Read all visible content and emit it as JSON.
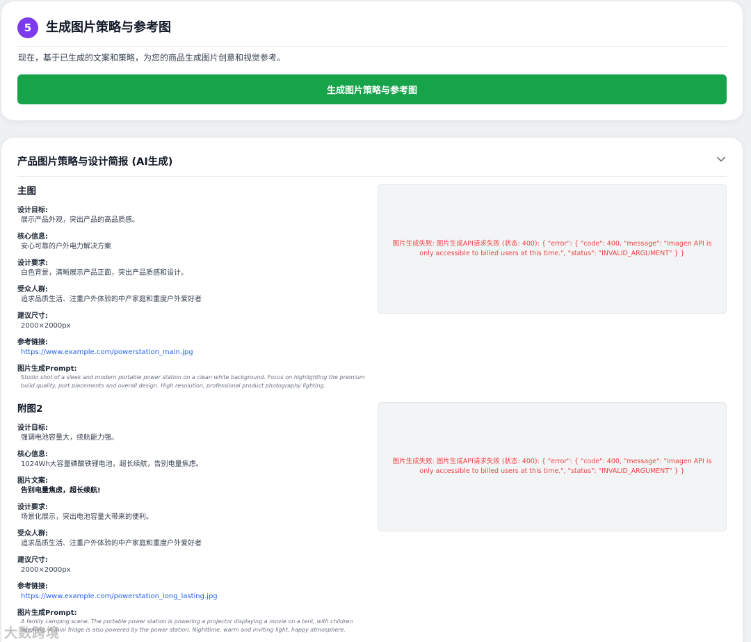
{
  "step": {
    "number": "5",
    "title": "生成图片策略与参考图",
    "description": "现在，基于已生成的文案和策略，为您的商品生成图片创意和视觉参考。",
    "button_label": "生成图片策略与参考图"
  },
  "brief": {
    "title": "产品图片策略与设计简报 (AI生成)",
    "toggle_icon": "chevron-down-icon",
    "sections": [
      {
        "title": "主图",
        "fields": [
          {
            "label": "设计目标:",
            "value": "展示产品外观，突出产品的高品质感。"
          },
          {
            "label": "核心信息:",
            "value": "安心可靠的户外电力解决方案"
          },
          {
            "label": "设计要求:",
            "value": "白色背景，清晰展示产品正面，突出产品质感和设计。"
          },
          {
            "label": "受众人群:",
            "value": "追求品质生活、注重户外体验的中产家庭和重度户外爱好者"
          },
          {
            "label": "建议尺寸:",
            "value": "2000×2000px"
          },
          {
            "label": "参考链接:",
            "value": "https://www.example.com/powerstation_main.jpg"
          },
          {
            "label": "图片生成Prompt:",
            "value": "Studio shot of a sleek and modern portable power station on a clean white background. Focus on highlighting the premium build quality, port placements and overall design. High resolution, professional product photography lighting."
          }
        ],
        "image_error": "图片生成失败: 图片生成API请求失败 (状态: 400): { \"error\": { \"code\": 400, \"message\": \"Imagen API is only accessible to billed users at this time.\", \"status\": \"INVALID_ARGUMENT\" } }"
      },
      {
        "title": "附图2",
        "fields": [
          {
            "label": "设计目标:",
            "value": "强调电池容量大，续航能力强。"
          },
          {
            "label": "核心信息:",
            "value": "1024Wh大容量磷酸铁锂电池，超长续航，告别电量焦虑。"
          },
          {
            "label": "图片文案:",
            "value": "告别电量焦虑，超长续航!"
          },
          {
            "label": "设计要求:",
            "value": "场景化展示，突出电池容量大带来的便利。"
          },
          {
            "label": "受众人群:",
            "value": "追求品质生活、注重户外体验的中产家庭和重度户外爱好者"
          },
          {
            "label": "建议尺寸:",
            "value": "2000×2000px"
          },
          {
            "label": "参考链接:",
            "value": "https://www.example.com/powerstation_long_lasting.jpg"
          },
          {
            "label": "图片生成Prompt:",
            "value": "A family camping scene. The portable power station is powering a projector displaying a movie on a tent, with children laughing. A mini fridge is also powered by the power station. Nighttime, warm and inviting light, happy atmosphere."
          }
        ],
        "image_error": "图片生成失败: 图片生成API请求失败 (状态: 400): { \"error\": { \"code\": 400, \"message\": \"Imagen API is only accessible to billed users at this time.\", \"status\": \"INVALID_ARGUMENT\" } }"
      }
    ]
  },
  "watermark": "大数跨境",
  "colors": {
    "accent_purple": "#7c3aed",
    "button_green": "#16a34a",
    "error_red": "#ef4444",
    "link_blue": "#2563eb"
  }
}
